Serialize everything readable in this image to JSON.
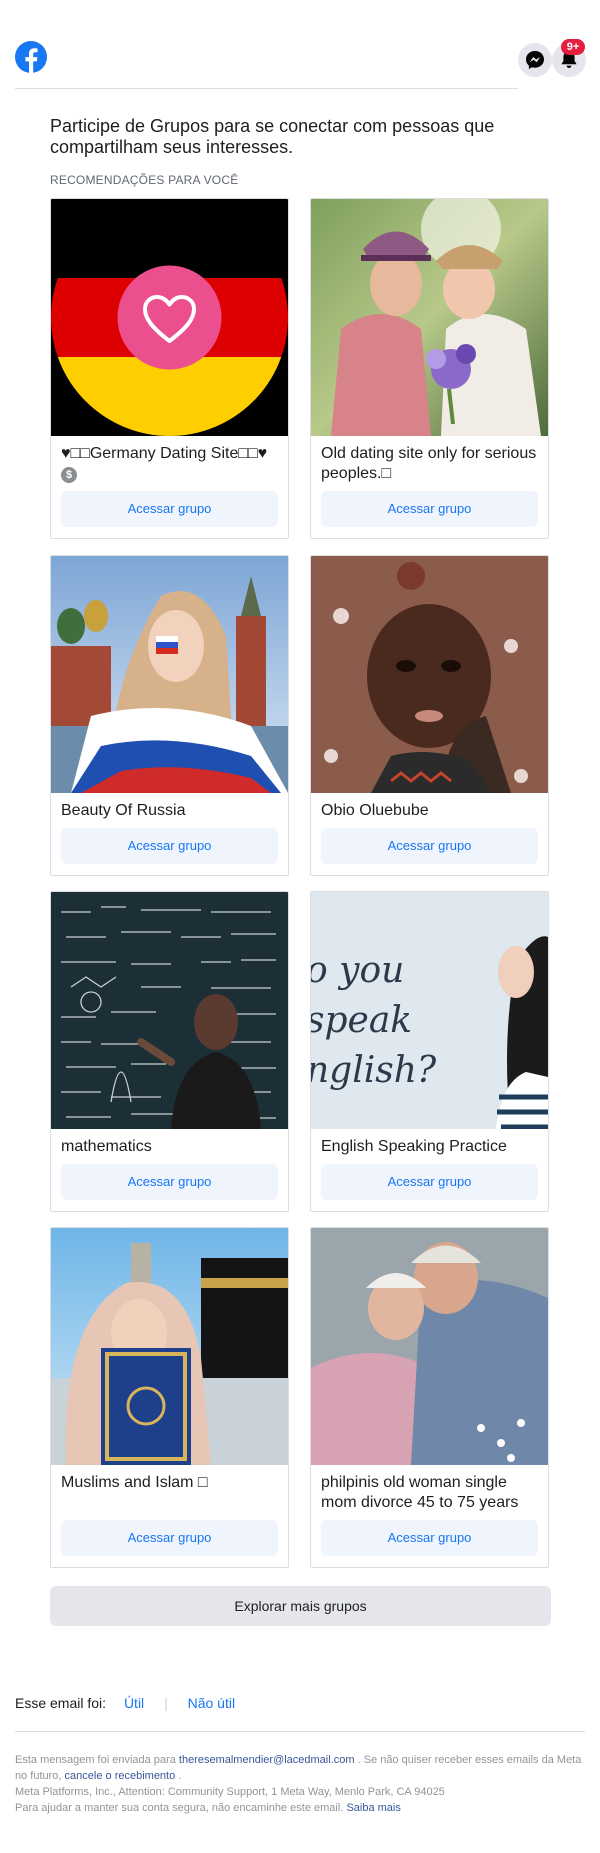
{
  "header": {
    "logo_icon": "facebook-logo-icon",
    "messenger_icon": "messenger-icon",
    "notifications_icon": "bell-icon",
    "notification_badge": "9+",
    "brand_color": "#1877f2"
  },
  "intro": {
    "text": "Participe de Grupos para se conectar com pessoas que compartilham seus interesses.",
    "section_label": "RECOMENDAÇÕES PARA VOCÊ"
  },
  "groups": [
    {
      "name": "♥□□Germany Dating Site□□♥",
      "badge_icon": "money-icon",
      "button": "Acessar grupo"
    },
    {
      "name": "Old dating site only for serious peoples.□",
      "button": "Acessar grupo"
    },
    {
      "name": "Beauty Of Russia",
      "button": "Acessar grupo"
    },
    {
      "name": "Obio Oluebube",
      "button": "Acessar grupo"
    },
    {
      "name": "mathematics",
      "button": "Acessar grupo"
    },
    {
      "name": "English Speaking Practice",
      "button": "Acessar grupo"
    },
    {
      "name": "Muslims and Islam □",
      "button": "Acessar grupo"
    },
    {
      "name": "philpinis old woman single mom divorce 45 to 75 years",
      "button": "Acessar grupo"
    }
  ],
  "explore_button": "Explorar mais grupos",
  "feedback": {
    "prompt": "Esse email foi:",
    "useful": "Útil",
    "not_useful": "Não útil"
  },
  "footer": {
    "line1_prefix": "Esta mensagem foi enviada para",
    "email": "theresemalmendier@lacedmail.com",
    "line1_suffix": ". Se não quiser receber esses emails da Meta no futuro,",
    "unsubscribe": "cancele o recebimento",
    "line1_end": ".",
    "address": "Meta Platforms, Inc., Attention: Community Support, 1 Meta Way, Menlo Park, CA 94025",
    "safety_text": "Para ajudar a manter sua conta segura, não encaminhe este email.",
    "learn_more": "Saiba mais"
  }
}
